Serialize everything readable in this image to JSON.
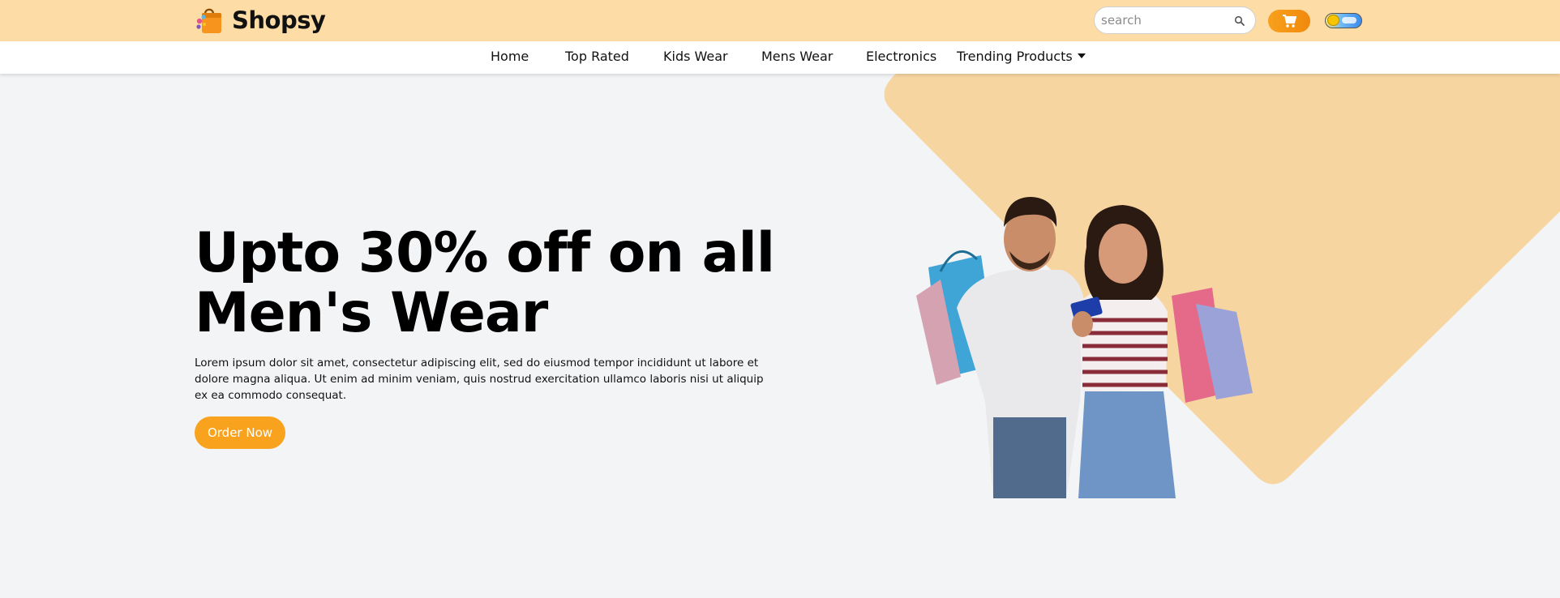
{
  "brand": {
    "name": "Shopsy",
    "icon": "shopping-bag-icon"
  },
  "header": {
    "search_placeholder": "search",
    "search_icon": "search-icon",
    "cart_icon": "cart-icon",
    "theme_toggle": "theme-toggle-switch"
  },
  "nav": {
    "items": [
      {
        "label": "Home"
      },
      {
        "label": "Top Rated"
      },
      {
        "label": "Kids Wear"
      },
      {
        "label": "Mens Wear"
      },
      {
        "label": "Electronics"
      },
      {
        "label": "Trending Products"
      }
    ]
  },
  "hero": {
    "title_line1": "Upto 30% off on all",
    "title_line2": "Men's Wear",
    "description": "Lorem ipsum dolor sit amet, consectetur adipiscing elit, sed do eiusmod tempor incididunt ut labore et dolore magna aliqua. Ut enim ad minim veniam, quis nostrud exercitation ullamco laboris nisi ut aliquip ex ea commodo consequat.",
    "cta_label": "Order Now"
  },
  "colors": {
    "topbar_bg": "#fddca5",
    "accent": "#f9a21e",
    "hero_shape": "#f7d5a0",
    "page_bg": "#f3f4f6"
  }
}
